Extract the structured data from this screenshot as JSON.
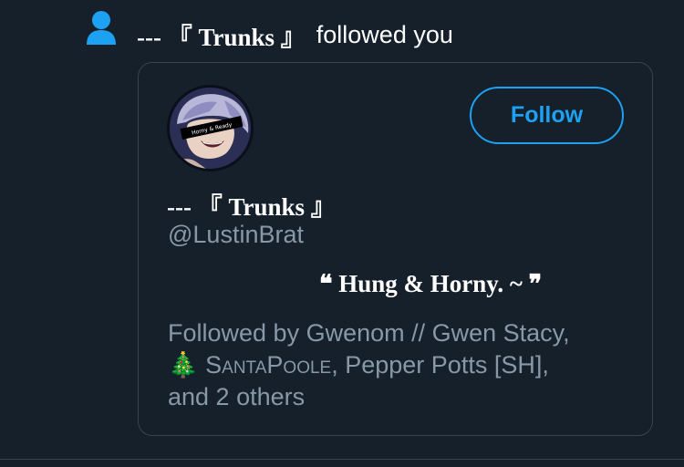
{
  "notification": {
    "icon": "person-icon",
    "actor_name": "---  『 Trunks 』",
    "action_text": "followed you"
  },
  "card": {
    "display_name": "---  『 Trunks 』",
    "handle": "@LustinBrat",
    "follow_button_label": "Follow",
    "bio": "❝ Hung & Horny. ~ ❞",
    "followed_by": {
      "prefix": "Followed by Gwenom // Gwen Stacy,",
      "tree_emoji": "🎄",
      "name_smallcaps": "SantaPoole",
      "middle": ", Pepper Potts [SH],",
      "suffix": "and 2 others"
    },
    "avatar_text": "Horny & Ready"
  },
  "colors": {
    "background": "#15202b",
    "accent": "#1da1f2",
    "muted_text": "#8899a6",
    "border": "#38444d"
  }
}
